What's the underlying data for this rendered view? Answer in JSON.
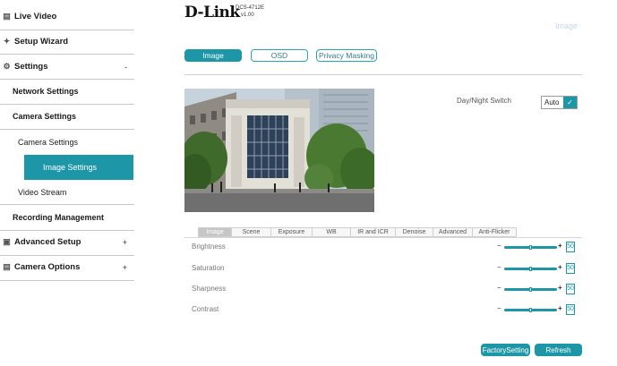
{
  "sidebar": {
    "live_video": "Live Video",
    "setup_wizard": "Setup Wizard",
    "settings": "Settings",
    "settings_toggle": "-",
    "network_settings": "Network Settings",
    "camera_settings_group": "Camera Settings",
    "camera_settings": "Camera Settings",
    "image_settings": "Image Settings",
    "video_stream": "Video Stream",
    "recording_management": "Recording Management",
    "advanced_setup": "Advanced Setup",
    "advanced_toggle": "+",
    "camera_options": "Camera Options",
    "camera_options_toggle": "+"
  },
  "header": {
    "logo": "D-Link",
    "model": "DCS-4712E",
    "version": "v1.00",
    "faint_title": "Image"
  },
  "top_tabs": [
    "Image",
    "OSD",
    "Privacy Masking"
  ],
  "active_top_tab": "Image",
  "day_night": {
    "label": "Day/Night Switch",
    "value": "Auto"
  },
  "sub_tabs": [
    "Image",
    "Scene",
    "Exposure",
    "WB",
    "IR and ICR",
    "Denoise",
    "Advanced",
    "Anti-Flicker"
  ],
  "active_sub_tab": "Image",
  "sliders": [
    {
      "label": "Brightness",
      "value": "50",
      "level": 0.5
    },
    {
      "label": "Saturation",
      "value": "50",
      "level": 0.5
    },
    {
      "label": "Sharpness",
      "value": "50",
      "level": 0.5
    },
    {
      "label": "Contrast",
      "value": "50",
      "level": 0.5
    }
  ],
  "slider_minus": "−",
  "slider_plus": "+",
  "buttons": {
    "factory": "FactorySetting",
    "refresh": "Refresh"
  },
  "colors": {
    "accent": "#1d97a8"
  },
  "icons": {
    "live_video": "video-icon",
    "setup_wizard": "wand-icon",
    "settings": "gear-icon",
    "advanced_setup": "advanced-icon",
    "camera_options": "document-icon",
    "dropdown": "chevron-down-icon"
  }
}
